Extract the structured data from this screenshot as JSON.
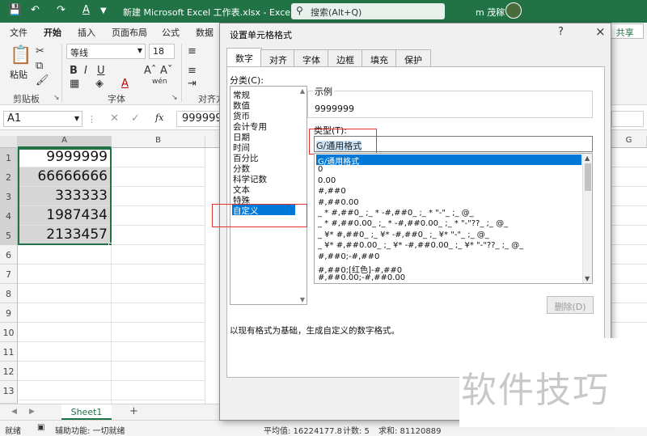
{
  "app": {
    "title": "新建 Microsoft Excel 工作表.xlsx  -  Excel",
    "search_placeholder": "搜索(Alt+Q)",
    "user": "m 茂稼",
    "accent": "#217346"
  },
  "ribbon": {
    "tabs": [
      "文件",
      "开始",
      "插入",
      "页面布局",
      "公式",
      "数据"
    ],
    "active_tab": "开始",
    "share_label": "共享",
    "paste_label": "粘贴",
    "font_name": "等线",
    "font_size": "18",
    "clipboard_label": "剪贴板",
    "font_group_label": "字体",
    "align_group_label": "对齐方"
  },
  "formula_bar": {
    "name_box": "A1",
    "fx": "fx",
    "value": "9999999"
  },
  "grid": {
    "columns": [
      "A",
      "B",
      "G"
    ],
    "rows": [
      "1",
      "2",
      "3",
      "4",
      "5",
      "6",
      "7",
      "8",
      "9",
      "10",
      "11",
      "12",
      "13"
    ],
    "cells_A": [
      "9999999",
      "66666666",
      "333333",
      "1987434",
      "2133457"
    ]
  },
  "sheets": {
    "tabs": [
      "Sheet1"
    ],
    "add_label": "+"
  },
  "status": {
    "ready": "就绪",
    "accessibility": "辅助功能: 一切就绪",
    "average": "平均值: 16224177.8",
    "count": "计数: 5",
    "sum": "求和: 81120889"
  },
  "dialog": {
    "title": "设置单元格格式",
    "help": "?",
    "close": "×",
    "tabs": [
      "数字",
      "对齐",
      "字体",
      "边框",
      "填充",
      "保护"
    ],
    "active_tab": "数字",
    "category_label": "分类(C):",
    "categories": [
      "常规",
      "数值",
      "货币",
      "会计专用",
      "日期",
      "时间",
      "百分比",
      "分数",
      "科学记数",
      "文本",
      "特殊",
      "自定义"
    ],
    "selected_category": "自定义",
    "sample_label": "示例",
    "sample_value": "9999999",
    "type_label": "类型(T):",
    "type_value": "G/通用格式",
    "formats": [
      "G/通用格式",
      "0",
      "0.00",
      "#,##0",
      "#,##0.00",
      "_ * #,##0_ ;_ * -#,##0_ ;_ * \"-\"_ ;_ @_ ",
      "_ * #,##0.00_ ;_ * -#,##0.00_ ;_ * \"-\"??_ ;_ @_ ",
      "_ ¥* #,##0_ ;_ ¥* -#,##0_ ;_ ¥* \"-\"_ ;_ @_ ",
      "_ ¥* #,##0.00_ ;_ ¥* -#,##0.00_ ;_ ¥* \"-\"??_ ;_ @_ ",
      "#,##0;-#,##0",
      "#,##0;[红色]-#,##0",
      "#,##0.00;-#,##0.00"
    ],
    "delete_label": "删除(D)",
    "description": "以现有格式为基础，生成自定义的数字格式。"
  },
  "watermark": "软件技巧"
}
